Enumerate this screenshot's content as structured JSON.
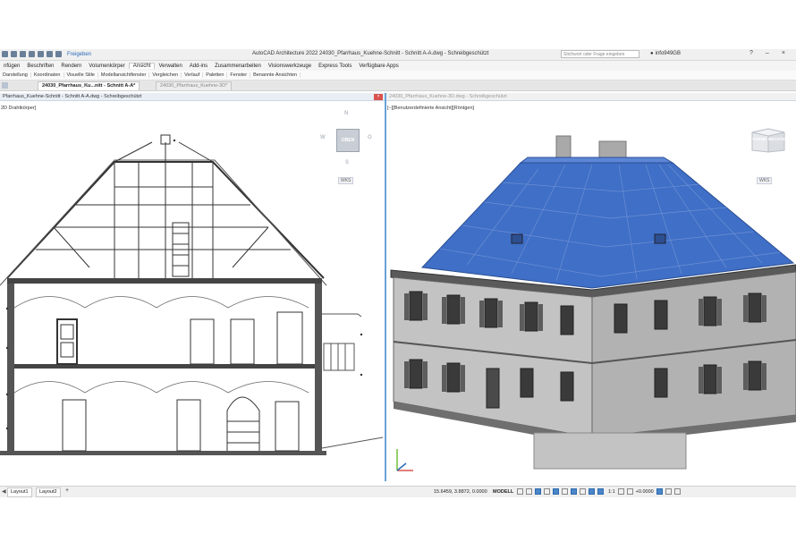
{
  "app": {
    "window_title": "AutoCAD Architecture 2022    24030_Pfarrhaus_Kuehne-Schnitt - Schnitt A-A.dwg - Schreibgeschützt",
    "share_label": "Freigeben",
    "search_placeholder": "Stichwort oder Frage eingeben",
    "user_name": "info949GB",
    "help_label": "?"
  },
  "ribbon_tabs": [
    {
      "label": "nfügen"
    },
    {
      "label": "Beschriften"
    },
    {
      "label": "Rendern"
    },
    {
      "label": "Volumenkörper"
    },
    {
      "label": "Ansicht",
      "active": true
    },
    {
      "label": "Verwalten"
    },
    {
      "label": "Add-ins"
    },
    {
      "label": "Zusammenarbeiten"
    },
    {
      "label": "Visionswerkzeuge"
    },
    {
      "label": "Express Tools"
    },
    {
      "label": "Verfügbare Apps"
    }
  ],
  "ribbon_panels": [
    "Darstellung",
    "Koordinaten",
    "Visuelle Stile",
    "Modellansichtfenster",
    "Vergleichen",
    "Verlauf",
    "Paletten",
    "Fenster",
    "Benannte Ansichten"
  ],
  "doc_tabs": [
    {
      "label": "24030_Pfarrhaus_Ku...nitt - Schnitt A-A*",
      "active": true
    },
    {
      "label": "24030_Pfarrhaus_Kuehne-3D*",
      "active": false
    }
  ],
  "left_viewport": {
    "header": "Pfarrhaus_Kuehne-Schnitt - Schnitt A-A.dwg - Schreibgeschützt",
    "view_label": "2D Drahtkörper]",
    "viewcube": {
      "face": "OBEN",
      "n": "N",
      "s": "S",
      "w": "W",
      "o": "O"
    },
    "wcs": "WKS"
  },
  "right_viewport": {
    "header": "24030_Pfarrhaus_Kuehne-3D.dwg - Schreibgeschützt",
    "view_label": "[−][Benutzerdefinierte Ansicht][Röntgen]",
    "viewcube": {
      "face1": "VORNE",
      "face2": "RECHTS"
    },
    "wcs": "WKS"
  },
  "status": {
    "layout_tabs": [
      "Layout1",
      "Layout2"
    ],
    "coords": "15.6459, 3.8872, 0.0000",
    "model": "MODELL",
    "scale": "1:1",
    "offset": "+0.0000"
  },
  "colors": {
    "roof_blue": "#3f6fc6",
    "viewport_border": "#6aa2d8",
    "accent": "#2a6bb8"
  }
}
